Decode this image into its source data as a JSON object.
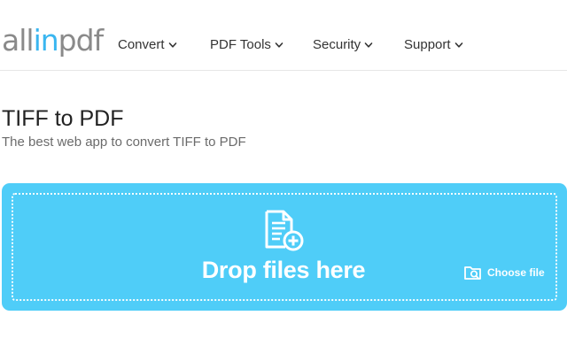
{
  "logo": {
    "part1": "all",
    "part2": "in",
    "part3": "pdf"
  },
  "nav": {
    "items": [
      {
        "label": "Convert",
        "icon": "chevron-down-icon"
      },
      {
        "label": "PDF Tools",
        "icon": "chevron-down-icon"
      },
      {
        "label": "Security",
        "icon": "chevron-down-icon"
      },
      {
        "label": "Support",
        "icon": "chevron-down-icon"
      }
    ]
  },
  "main": {
    "title": "TIFF to PDF",
    "subtitle": "The best web app to convert TIFF to PDF"
  },
  "dropzone": {
    "label": "Drop files here",
    "choose_file": "Choose file",
    "icon": "file-add-icon",
    "choose_icon": "folder-search-icon"
  },
  "colors": {
    "accent": "#3ab6f0",
    "dropzone_bg": "#4fcdf8",
    "logo_gray": "#8a8a8a"
  }
}
